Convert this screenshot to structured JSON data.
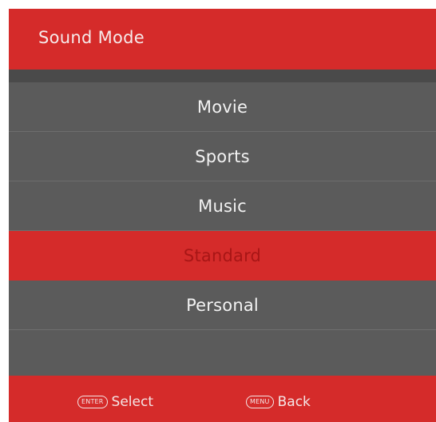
{
  "menu": {
    "title": "Sound Mode",
    "items": [
      {
        "label": "Movie",
        "selected": false
      },
      {
        "label": "Sports",
        "selected": false
      },
      {
        "label": "Music",
        "selected": false
      },
      {
        "label": "Standard",
        "selected": true
      },
      {
        "label": "Personal",
        "selected": false
      }
    ]
  },
  "footer": {
    "select_key": "ENTER",
    "select_label": "Select",
    "back_key": "MENU",
    "back_label": "Back"
  },
  "colors": {
    "accent": "#d52b2a",
    "item_background": "#5b5b5b",
    "text": "#f2f2f2"
  }
}
